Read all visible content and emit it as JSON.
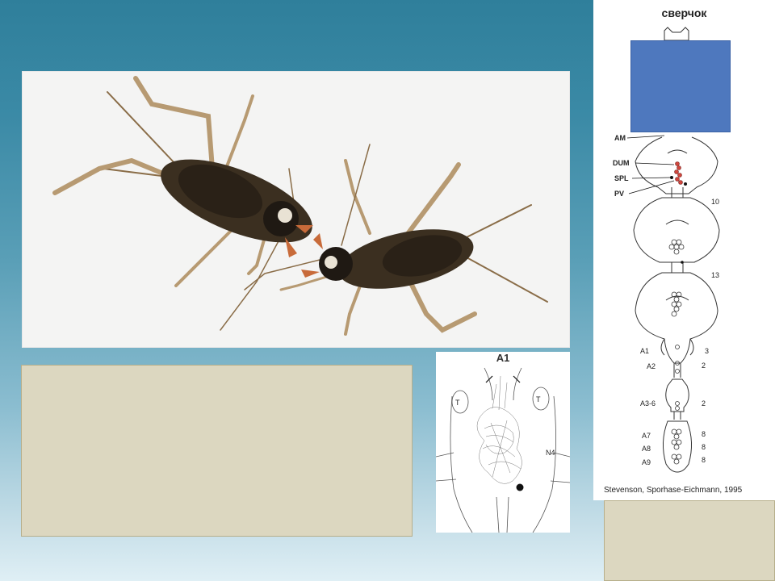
{
  "diagram": {
    "title": "сверчок",
    "citation": "Stevenson, Sporhase-Eichmann, 1995",
    "neuron_labels": [
      "AM",
      "DUM",
      "SPL",
      "PV"
    ],
    "segment_labels": [
      "A1",
      "A2",
      "A3-6",
      "A7",
      "A8",
      "A9"
    ],
    "counts": [
      "10",
      "13",
      "3",
      "2",
      "2",
      "8",
      "8",
      "8"
    ]
  },
  "inset": {
    "title": "A1",
    "label_t_left": "T",
    "label_t_right": "T",
    "label_n4": "N4"
  },
  "colors": {
    "background_top": "#2f7f9b",
    "background_bottom": "#dfeff5",
    "tan_box": "#dcd7c0",
    "blue_box": "#4e78be",
    "highlight_cells": "#d0463e"
  }
}
